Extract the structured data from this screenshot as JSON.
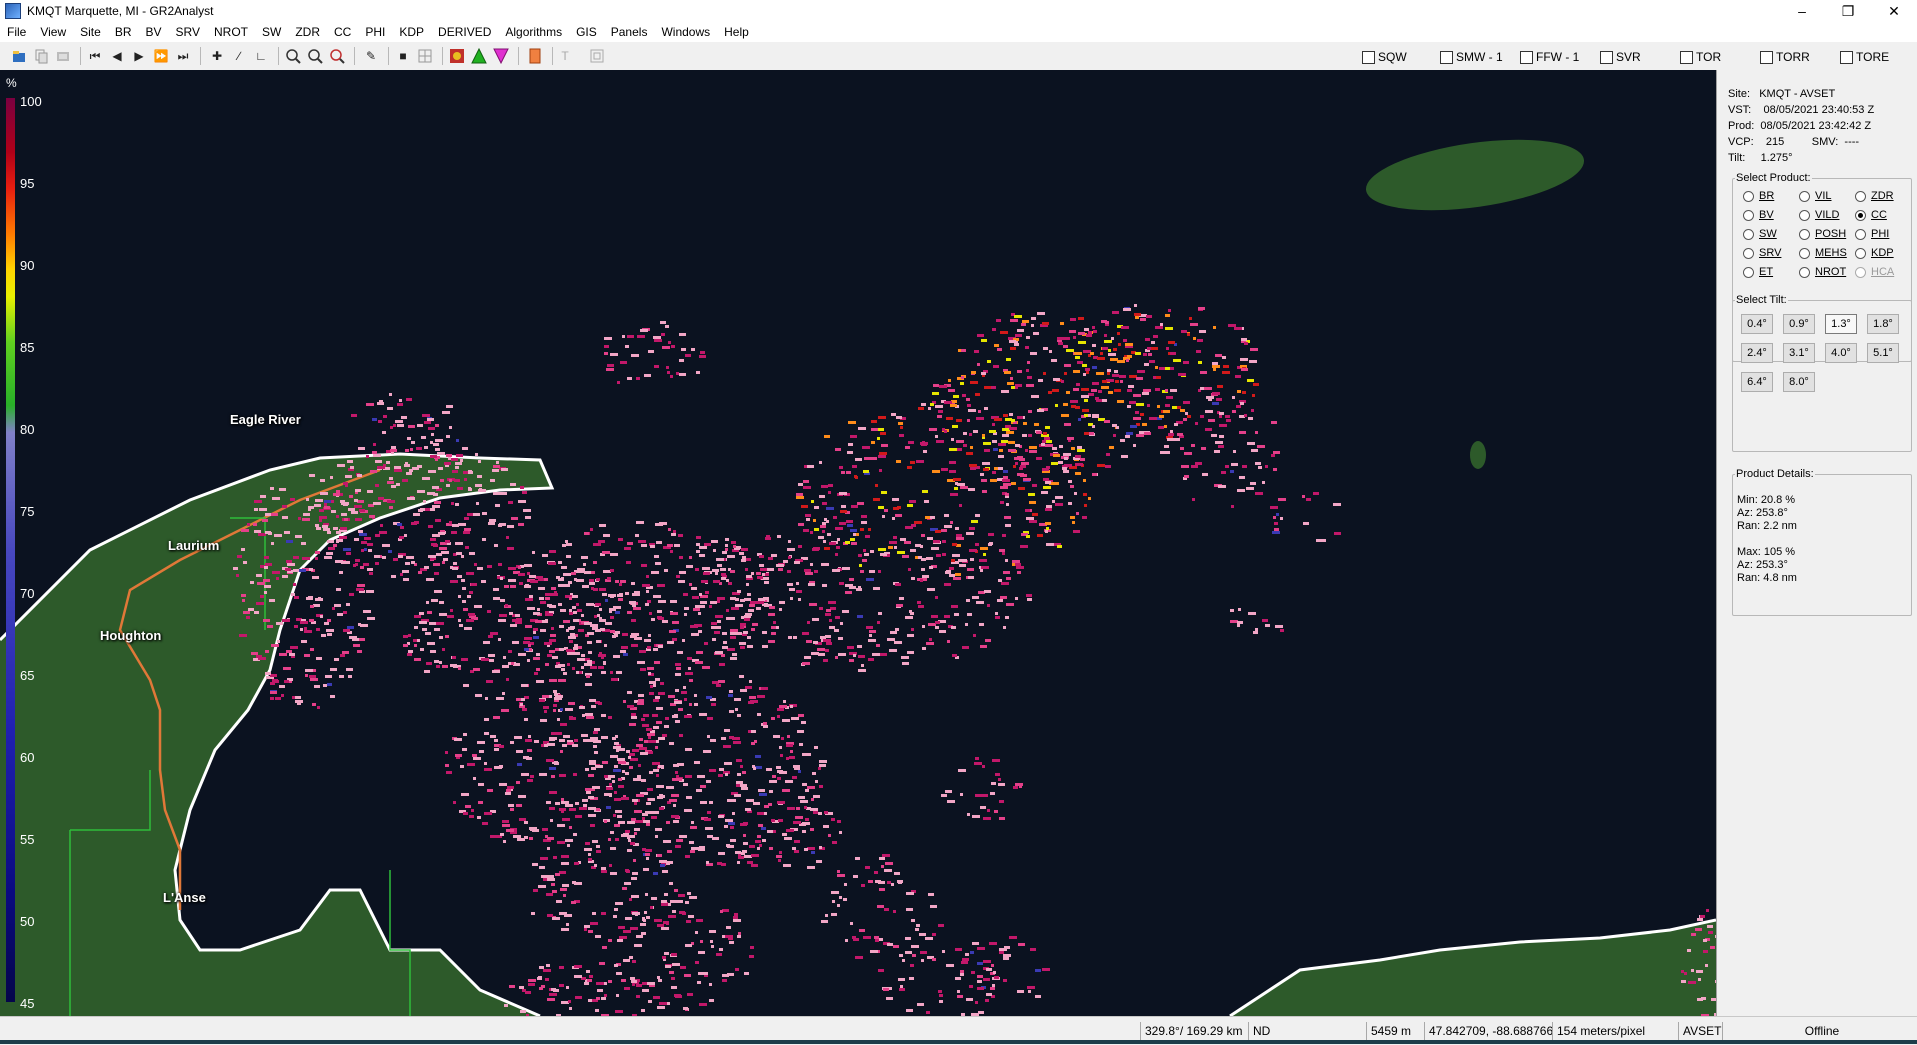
{
  "window": {
    "title": "KMQT Marquette, MI - GR2Analyst"
  },
  "menu": [
    "File",
    "View",
    "Site",
    "BR",
    "BV",
    "SRV",
    "NROT",
    "SW",
    "ZDR",
    "CC",
    "PHI",
    "KDP",
    "DERIVED",
    "Algorithms",
    "GIS",
    "Panels",
    "Windows",
    "Help"
  ],
  "toolbar": {
    "icons": [
      "open-icon",
      "copy-icon",
      "export-icon",
      "skip-first-icon",
      "step-back-icon",
      "play-icon",
      "step-forward-icon",
      "skip-last-icon",
      "pan-icon",
      "measure-icon",
      "angle-icon",
      "zoom-in-icon",
      "zoom-out-icon",
      "zoom-reset-icon",
      "pencil-icon",
      "stop-icon",
      "grid-icon",
      "color-table-icon",
      "green-triangle-icon",
      "magenta-triangle-icon",
      "orange-box-icon",
      "text-icon",
      "frame-icon"
    ],
    "warnings": [
      {
        "label": "SQW",
        "checked": false
      },
      {
        "label": "SMW - 1",
        "checked": false
      },
      {
        "label": "FFW - 1",
        "checked": false
      },
      {
        "label": "SVR",
        "checked": false
      },
      {
        "label": "TOR",
        "checked": false
      },
      {
        "label": "TORR",
        "checked": false
      },
      {
        "label": "TORE",
        "checked": false
      }
    ]
  },
  "colorscale": {
    "unit": "%",
    "ticks": [
      "100",
      "95",
      "90",
      "85",
      "80",
      "75",
      "70",
      "65",
      "60",
      "55",
      "50",
      "45"
    ]
  },
  "map": {
    "labels": [
      "Eagle River",
      "Laurium",
      "Houghton",
      "L'Anse"
    ],
    "land_color": "#2d5a2a",
    "water_color": "#0b1220",
    "coast_color": "#ffffff",
    "road_color": "#e07838",
    "boundary_color": "#2ebd3a",
    "echo_colors": [
      "#f2a6c6",
      "#c2186a",
      "#e4408a",
      "#d21a1a",
      "#ff8c1a",
      "#e6e600",
      "#50c840",
      "#3a3ab4"
    ]
  },
  "info": {
    "site": {
      "label": "Site:",
      "value": "KMQT - AVSET"
    },
    "vst": {
      "label": "VST:",
      "value": "08/05/2021  23:40:53 Z"
    },
    "prod": {
      "label": "Prod:",
      "value": "08/05/2021  23:42:42 Z"
    },
    "vcp": {
      "label": "VCP:",
      "value": "215",
      "smv_label": "SMV:",
      "smv_value": "----"
    },
    "tilt": {
      "label": "Tilt:",
      "value": "1.275°"
    }
  },
  "select_product": {
    "title": "Select Product:",
    "products": [
      {
        "label": "BR",
        "selected": false,
        "enabled": true
      },
      {
        "label": "VIL",
        "selected": false,
        "enabled": true
      },
      {
        "label": "ZDR",
        "selected": false,
        "enabled": true
      },
      {
        "label": "BV",
        "selected": false,
        "enabled": true
      },
      {
        "label": "VILD",
        "selected": false,
        "enabled": true
      },
      {
        "label": "CC",
        "selected": true,
        "enabled": true
      },
      {
        "label": "SW",
        "selected": false,
        "enabled": true
      },
      {
        "label": "POSH",
        "selected": false,
        "enabled": true
      },
      {
        "label": "PHI",
        "selected": false,
        "enabled": true
      },
      {
        "label": "SRV",
        "selected": false,
        "enabled": true
      },
      {
        "label": "MEHS",
        "selected": false,
        "enabled": true
      },
      {
        "label": "KDP",
        "selected": false,
        "enabled": true
      },
      {
        "label": "ET",
        "selected": false,
        "enabled": true
      },
      {
        "label": "NROT",
        "selected": false,
        "enabled": true
      },
      {
        "label": "HCA",
        "selected": false,
        "enabled": false
      }
    ]
  },
  "select_tilt": {
    "title": "Select Tilt:",
    "tilts": [
      {
        "label": "0.4°",
        "selected": false
      },
      {
        "label": "0.9°",
        "selected": false
      },
      {
        "label": "1.3°",
        "selected": true
      },
      {
        "label": "1.8°",
        "selected": false
      },
      {
        "label": "2.4°",
        "selected": false
      },
      {
        "label": "3.1°",
        "selected": false
      },
      {
        "label": "4.0°",
        "selected": false
      },
      {
        "label": "5.1°",
        "selected": false
      },
      {
        "label": "6.4°",
        "selected": false
      },
      {
        "label": "8.0°",
        "selected": false
      }
    ]
  },
  "product_details": {
    "title": "Product Details:",
    "lines": [
      "Min:  20.8 %",
      "Az:   253.8°",
      "Ran:  2.2 nm",
      "",
      "Max:  105 %",
      "Az:   253.3°",
      "Ran:  4.8 nm"
    ]
  },
  "status": {
    "az_range": "329.8°/ 169.29 km",
    "nd": "ND",
    "height": "5459 m",
    "latlon": "47.842709, -88.688766",
    "resolution": "154 meters/pixel",
    "site": "AVSET",
    "connection": "Offline"
  }
}
